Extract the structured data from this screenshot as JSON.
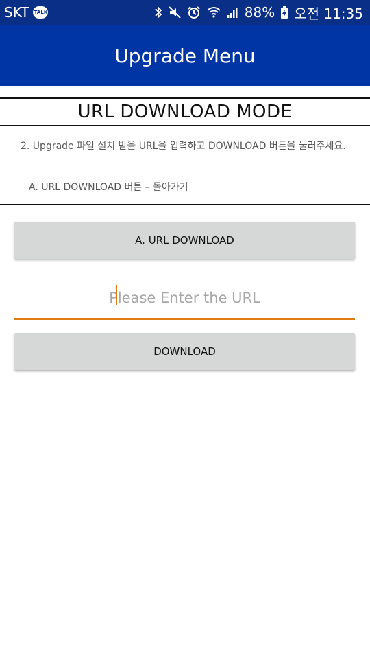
{
  "status_bar": {
    "carrier": "SKT",
    "talk_badge": "TALK",
    "battery": "88%",
    "time": "오전 11:35",
    "icons": [
      "bluetooth-icon",
      "mute-icon",
      "alarm-icon",
      "wifi-icon",
      "signal-icon",
      "battery-charging-icon"
    ]
  },
  "app_bar": {
    "title": "Upgrade Menu",
    "color": "#0035a6"
  },
  "mode": {
    "title": "URL DOWNLOAD MODE"
  },
  "instructions": {
    "main": "2. Upgrade 파일 설치 받을 URL을 입력하고 DOWNLOAD 버튼을 눌러주세요.",
    "sub": "A. URL DOWNLOAD 버튼 – 돌아가기"
  },
  "buttons": {
    "url_download": "A. URL DOWNLOAD",
    "download": "DOWNLOAD"
  },
  "url_input": {
    "value": "",
    "placeholder": "Please Enter the URL",
    "accent_color": "#e07b12"
  }
}
